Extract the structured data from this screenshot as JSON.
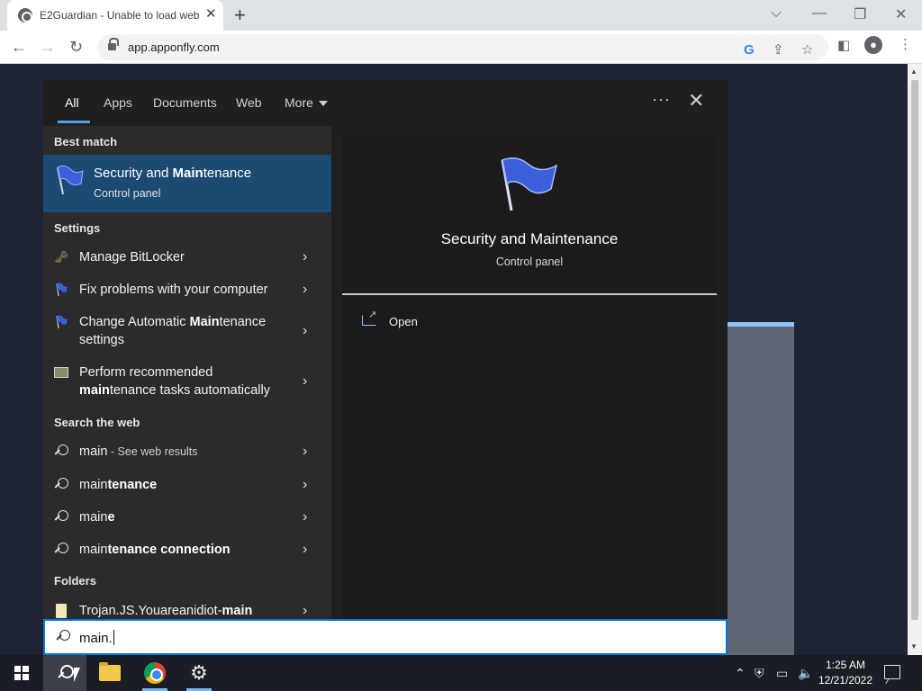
{
  "browser": {
    "tab_title": "E2Guardian - Unable to load web",
    "tab_close": "✕",
    "new_tab": "+",
    "url": "app.apponfly.com",
    "window_controls": {
      "dropdown": "⌵",
      "minimize": "—",
      "restore": "❐",
      "close": "✕"
    }
  },
  "search_panel": {
    "tabs": [
      {
        "label": "All",
        "active": true
      },
      {
        "label": "Apps"
      },
      {
        "label": "Documents"
      },
      {
        "label": "Web"
      },
      {
        "label": "More"
      }
    ],
    "options_dots": "···",
    "close": "✕",
    "best_match": {
      "header": "Best match",
      "title_pre": "Security and ",
      "title_bold": "Main",
      "title_post": "tenance",
      "subtitle": "Control panel"
    },
    "settings": {
      "header": "Settings",
      "items": [
        {
          "pre": "Manage BitLocker",
          "bold": "",
          "post": "",
          "line2_pre": "",
          "line2_bold": "",
          "line2_post": ""
        },
        {
          "pre": "Fix problems with your computer",
          "bold": "",
          "post": "",
          "line2_pre": "",
          "line2_bold": "",
          "line2_post": ""
        },
        {
          "pre": "Change Automatic ",
          "bold": "Main",
          "post": "tenance",
          "line2_pre": "settings",
          "line2_bold": "",
          "line2_post": ""
        },
        {
          "pre": "Perform recommended",
          "bold": "",
          "post": "",
          "line2_pre": "",
          "line2_bold": "main",
          "line2_post": "tenance tasks automatically"
        }
      ]
    },
    "web": {
      "header": "Search the web",
      "items": [
        {
          "pre": "main",
          "bold": "",
          "suffix": " - See web results"
        },
        {
          "pre": "main",
          "bold": "tenance",
          "suffix": ""
        },
        {
          "pre": "main",
          "bold": "e",
          "suffix": ""
        },
        {
          "pre": "main",
          "bold": "tenance connection",
          "suffix": ""
        }
      ]
    },
    "folders": {
      "header": "Folders",
      "items": [
        {
          "pre": "Trojan.JS.Youareanidiot-",
          "bold": "main"
        }
      ]
    },
    "detail": {
      "title": "Security and Maintenance",
      "subtitle": "Control panel",
      "action_open": "Open"
    },
    "query": "main."
  },
  "taskbar": {
    "time": "1:25 AM",
    "date": "12/21/2022"
  },
  "colors": {
    "accent": "#0078d4",
    "best_match_bg": "#1c4a72",
    "panel_bg": "#2b2b2b"
  }
}
